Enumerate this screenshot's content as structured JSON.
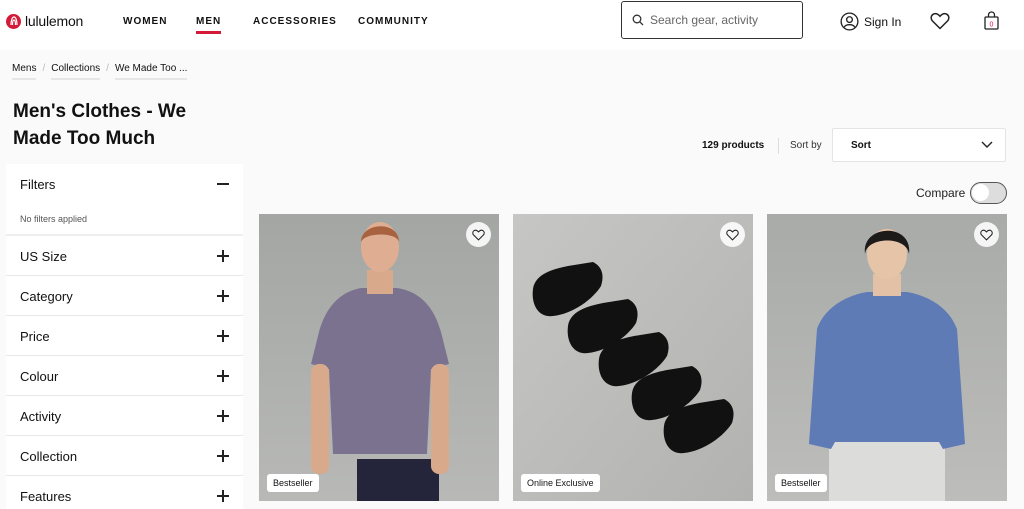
{
  "header": {
    "brand": "lululemon",
    "nav": [
      {
        "label": "WOMEN",
        "active": false
      },
      {
        "label": "MEN",
        "active": true
      },
      {
        "label": "ACCESSORIES",
        "active": false
      },
      {
        "label": "COMMUNITY",
        "active": false
      }
    ],
    "search_placeholder": "Search gear, activity",
    "sign_in": "Sign In",
    "bag_count": "0",
    "accent": "#d31a38"
  },
  "breadcrumb": [
    "Mens",
    "Collections",
    "We Made Too ..."
  ],
  "page_title": "Men's Clothes - We Made Too Much",
  "filters": {
    "title": "Filters",
    "status": "No filters applied",
    "groups": [
      "US Size",
      "Category",
      "Price",
      "Colour",
      "Activity",
      "Collection",
      "Features"
    ]
  },
  "toolbar": {
    "product_count": "129 products",
    "sort_by_label": "Sort by",
    "sort_value": "Sort",
    "compare_label": "Compare",
    "compare_on": false
  },
  "products": [
    {
      "name": "t-shirt",
      "badge": "Bestseller"
    },
    {
      "name": "socks",
      "badge": "Online Exclusive"
    },
    {
      "name": "crewneck",
      "badge": "Bestseller"
    }
  ]
}
